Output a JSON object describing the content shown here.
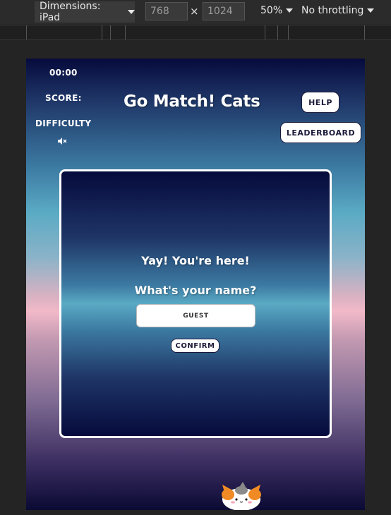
{
  "devtools": {
    "dimensions_label": "Dimensions: iPad",
    "width": "768",
    "height": "1024",
    "times": "×",
    "zoom": "50%",
    "throttling": "No throttling"
  },
  "game": {
    "timer": "00:00",
    "score_label": "SCORE:",
    "difficulty_label": "DIFFICULTY",
    "title": "Go Match! Cats",
    "help_label": "HELP",
    "leaderboard_label": "LEADERBOARD",
    "mute_icon": "muted-speaker-icon"
  },
  "modal": {
    "greeting": "Yay! You're here!",
    "question": "What's your name?",
    "name_value": "GUEST",
    "confirm_label": "CONFIRM"
  },
  "colors": {
    "bg_top": "#060a3c",
    "bg_teal": "#5aaac4",
    "bg_pink": "#f2b9c8",
    "button_text": "#1b1b3a"
  }
}
